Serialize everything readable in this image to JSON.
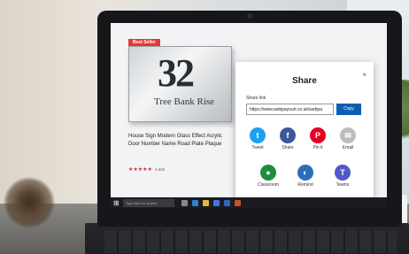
{
  "product": {
    "badge": "Best Seller",
    "plaque_number": "32",
    "plaque_text": "Tree Bank Rise",
    "title": "House Sign Modern Glass Effect Acrylic Door Number Name Road Plate Plaque",
    "stars": "★★★★★",
    "rating_count": "4,693"
  },
  "share_dialog": {
    "title": "Share",
    "close_glyph": "×",
    "link_label": "Share link",
    "link_value": "https://www.webpayourl.co.uk/webpa",
    "copy_label": "Copy",
    "apps": [
      {
        "label": "Tweet",
        "icon": "twitter-icon",
        "color": "#1da1f2",
        "glyph": "t"
      },
      {
        "label": "Share",
        "icon": "facebook-icon",
        "color": "#3b5998",
        "glyph": "f"
      },
      {
        "label": "Pin it",
        "icon": "pinterest-icon",
        "color": "#e60023",
        "glyph": "P"
      },
      {
        "label": "Email",
        "icon": "email-icon",
        "color": "#9e9e9e",
        "glyph": "✉"
      },
      {
        "label": "Classroom",
        "icon": "google-classroom-icon",
        "color": "#1e8e3e",
        "glyph": "●"
      },
      {
        "label": "Remind",
        "icon": "remind-icon",
        "color": "#2c6fb7",
        "glyph": "◐"
      },
      {
        "label": "Teams",
        "icon": "teams-icon",
        "color": "#5059c9",
        "glyph": "T"
      }
    ]
  },
  "taskbar": {
    "search_placeholder": "Type here to search",
    "time": "",
    "date": ""
  },
  "colors": {
    "accent": "#0b5fb3",
    "badge": "#e53935"
  }
}
